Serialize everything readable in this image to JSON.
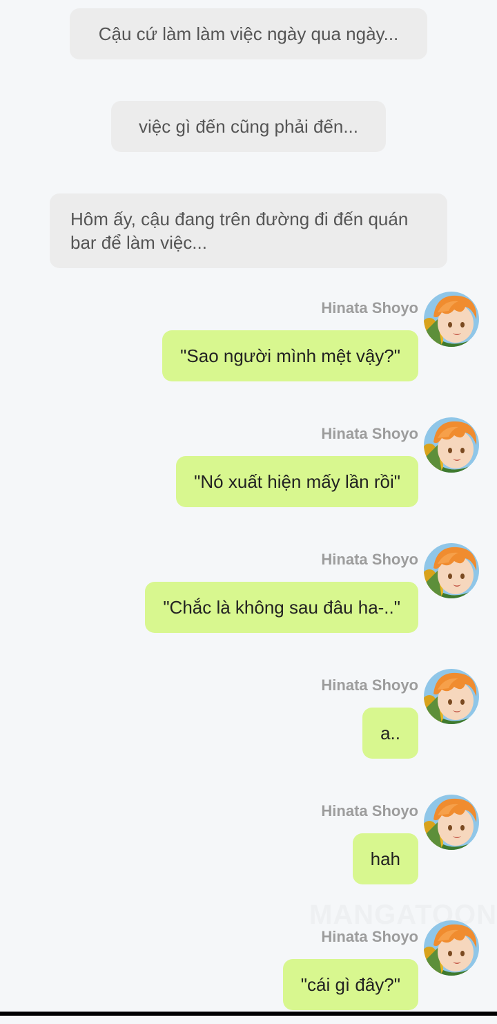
{
  "narrations": [
    {
      "text": "Cậu cứ làm làm việc ngày qua ngày..."
    },
    {
      "text": "việc gì đến cũng phải đến..."
    },
    {
      "text": "Hôm ấy, cậu đang trên đường đi đến quán bar để làm việc..."
    }
  ],
  "messages": [
    {
      "sender": "Hinata Shoyo",
      "text": "\"Sao người mình mệt vậy?\""
    },
    {
      "sender": "Hinata Shoyo",
      "text": "\"Nó xuất hiện mấy lần rồi\""
    },
    {
      "sender": "Hinata Shoyo",
      "text": "\"Chắc là không sau đâu ha-..\""
    },
    {
      "sender": "Hinata Shoyo",
      "text": "a.."
    },
    {
      "sender": "Hinata Shoyo",
      "text": "hah"
    },
    {
      "sender": "Hinata Shoyo",
      "text": "\"cái gì đây?\""
    }
  ],
  "watermark": "MANGATOON",
  "colors": {
    "background": "#f5f7f9",
    "narration_bubble": "#ececec",
    "message_bubble": "#d8f78f",
    "sender_name": "#9c9c9c"
  }
}
